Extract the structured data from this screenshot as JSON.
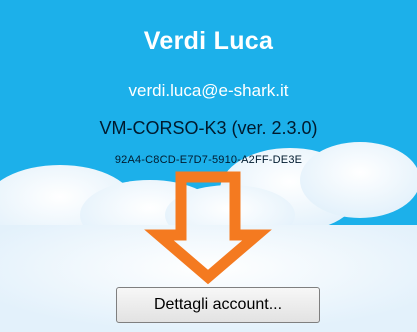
{
  "account": {
    "name": "Verdi Luca",
    "email": "verdi.luca@e-shark.it",
    "device": "VM-CORSO-K3 (ver. 2.3.0)",
    "serial": "92A4-C8CD-E7D7-5910-A2FF-DE3E"
  },
  "actions": {
    "details_button": "Dettagli account..."
  },
  "colors": {
    "sky": "#1cb0ea",
    "cloud": "#ffffff",
    "arrow": "#f47a20"
  },
  "icons": {
    "arrow": "down-arrow-icon"
  }
}
